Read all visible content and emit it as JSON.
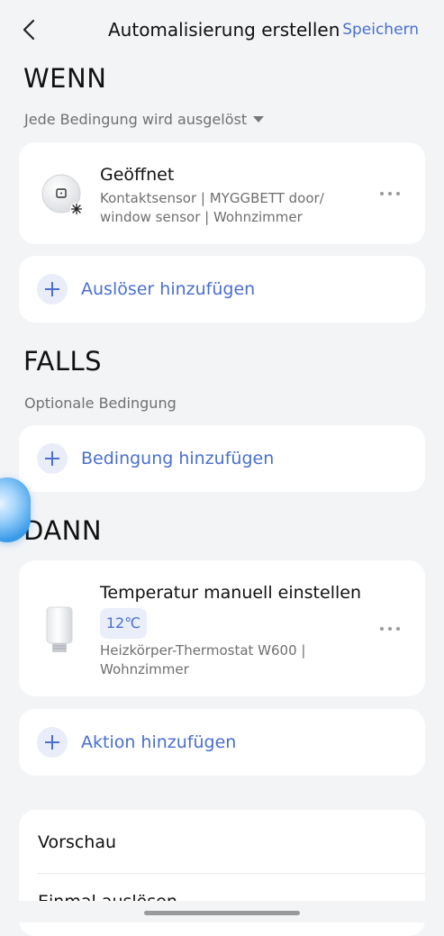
{
  "header": {
    "title": "Automalisierung erstellen",
    "save_label": "Speichern"
  },
  "when": {
    "title": "WENN",
    "mode": "Jede Bedingung wird ausgelöst",
    "trigger": {
      "title": "Geöffnet",
      "detail_line1": "Kontaktsensor | MYGGBETT door/",
      "detail_line2": "window sensor | Wohnzimmer",
      "icon": "contact-sensor-icon"
    },
    "add_label": "Auslöser hinzufügen"
  },
  "if": {
    "title": "FALLS",
    "subtitle": "Optionale Bedingung",
    "add_label": "Bedingung hinzufügen"
  },
  "then": {
    "title": "DANN",
    "action": {
      "title": "Temperatur manuell einstellen",
      "badge": "12℃",
      "detail_line1": "Heizkörper-Thermostat W600 |",
      "detail_line2": "Wohnzimmer",
      "icon": "thermostat-icon"
    },
    "add_label": "Aktion hinzufügen"
  },
  "bottom": {
    "preview_label": "Vorschau",
    "trigger_once_label": "Einmal auslösen"
  },
  "colors": {
    "accent": "#4a6fd0",
    "background": "#f3f4f6",
    "card": "#ffffff"
  }
}
